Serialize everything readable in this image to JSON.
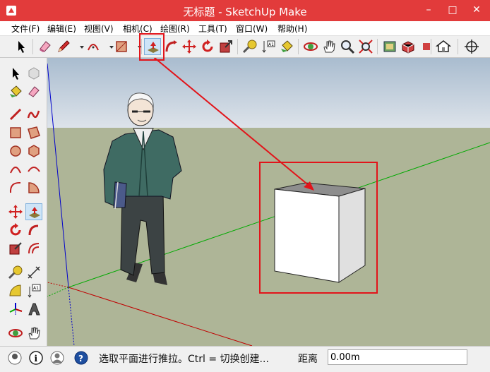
{
  "window": {
    "title": "无标题 - SketchUp Make",
    "minimize": "–",
    "maximize": "□",
    "close": "✕"
  },
  "menu": [
    {
      "label": "文件(F)"
    },
    {
      "label": "编辑(E)"
    },
    {
      "label": "视图(V)"
    },
    {
      "label": "相机(C)"
    },
    {
      "label": "绘图(R)"
    },
    {
      "label": "工具(T)"
    },
    {
      "label": "窗口(W)"
    },
    {
      "label": "帮助(H)"
    }
  ],
  "status": {
    "hint": "选取平面进行推拉。Ctrl = 切换创建...",
    "distance_label": "距离",
    "distance_value": "0.00m"
  },
  "colors": {
    "titlebar": "#e23b3b",
    "sky": "#b7c7d8",
    "ground": "#aeb597",
    "highlight": "#e2141a",
    "axis_red": "#c00000",
    "axis_green": "#00aa00",
    "axis_blue": "#0000cc"
  }
}
